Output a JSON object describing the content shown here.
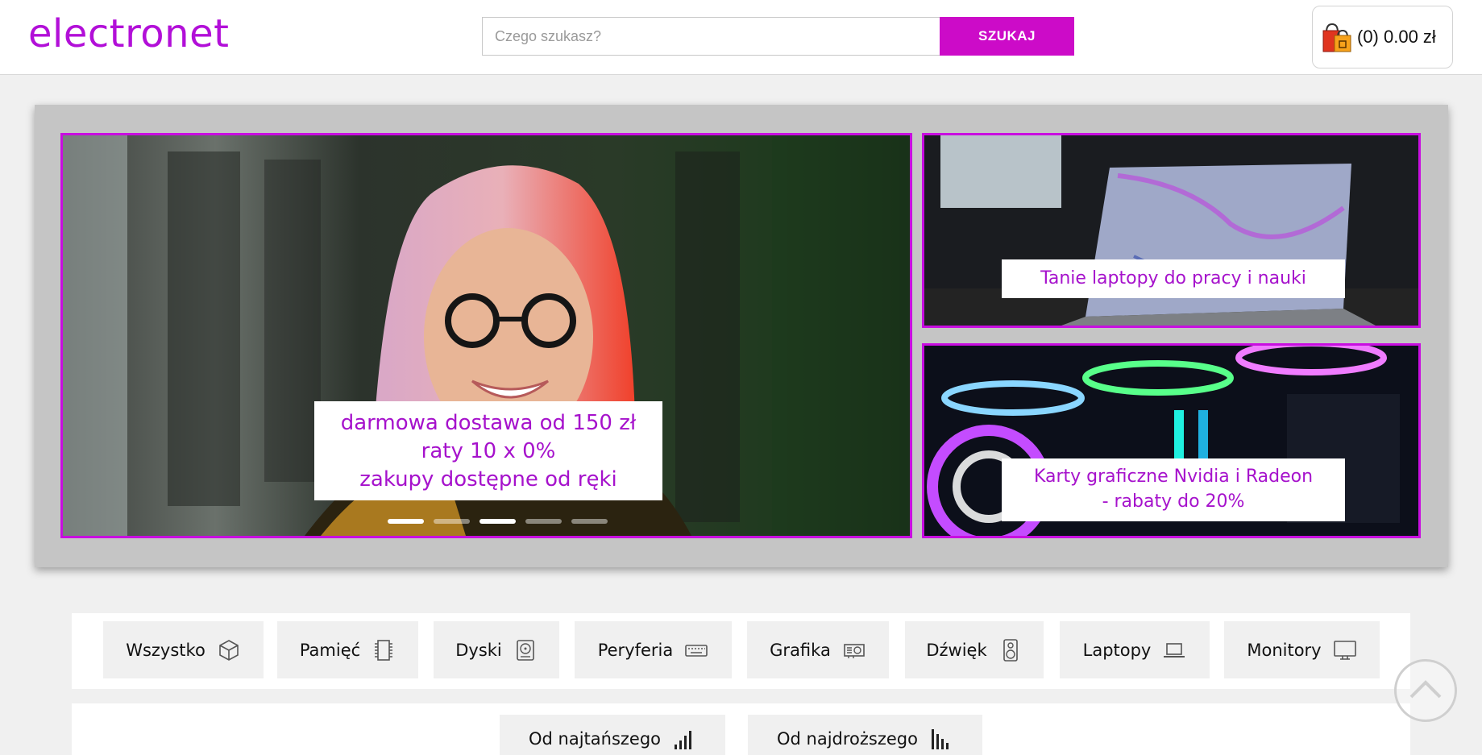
{
  "header": {
    "logo": "electronet",
    "search_placeholder": "Czego szukasz?",
    "search_button": "SZUKAJ",
    "cart_text": "(0) 0.00 zł"
  },
  "banner": {
    "main_promo": [
      "darmowa dostawa od 150 zł",
      "raty 10 x 0%",
      "zakupy dostępne od ręki"
    ],
    "side1_promo": "Tanie laptopy do pracy i nauki",
    "side2_promo": [
      "Karty graficzne Nvidia i Radeon",
      "- rabaty do 20%"
    ],
    "slide_count": 5,
    "active_slide": 1
  },
  "categories": [
    {
      "label": "Wszystko",
      "icon": "cube-icon"
    },
    {
      "label": "Pamięć",
      "icon": "memory-chip-icon"
    },
    {
      "label": "Dyski",
      "icon": "hard-disk-icon"
    },
    {
      "label": "Peryferia",
      "icon": "keyboard-icon"
    },
    {
      "label": "Grafika",
      "icon": "graphics-card-icon"
    },
    {
      "label": "Dźwięk",
      "icon": "speaker-icon"
    },
    {
      "label": "Laptopy",
      "icon": "laptop-icon"
    },
    {
      "label": "Monitory",
      "icon": "monitor-icon"
    }
  ],
  "sort": [
    {
      "label": "Od najtańszego",
      "icon": "sort-ascending-icon"
    },
    {
      "label": "Od najdroższego",
      "icon": "sort-descending-icon"
    }
  ],
  "colors": {
    "accent": "#cc0bc8",
    "promo_text": "#a612cc"
  }
}
